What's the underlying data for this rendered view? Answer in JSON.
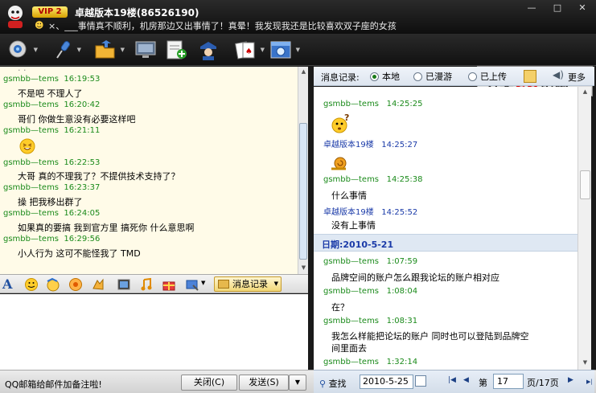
{
  "title_bar": {
    "vip_badge": "VIP 2",
    "contact_name": "卓越版本19楼(86526190)",
    "signature": "×、___事情真不顺利，机房那边又出事情了！真晕！我发现我还是比较喜欢双子座的女孩",
    "minimize": "—",
    "maximize": "□",
    "close": "✕"
  },
  "banner": {
    "text_a": "另类",
    "text_cg": "CG",
    "text_b": "花絮"
  },
  "chat": {
    "messages": [
      {
        "sender": "gsmbb—tems",
        "time": "16:19:53",
        "text": "不是吧 不理人了"
      },
      {
        "sender": "gsmbb—tems",
        "time": "16:20:42",
        "text": "哥们 你做生意没有必要这样吧"
      },
      {
        "sender": "gsmbb—tems",
        "time": "16:21:11",
        "text": ""
      },
      {
        "sender": "gsmbb—tems",
        "time": "16:22:53",
        "text": "大哥 真的不理我了？不提供技术支持了？"
      },
      {
        "sender": "gsmbb—tems",
        "time": "16:23:37",
        "text": "操 把我移出群了"
      },
      {
        "sender": "gsmbb—tems",
        "time": "16:24:05",
        "text": "如果真的要搞 我到官方里 搞死你 什么意思啊"
      },
      {
        "sender": "gsmbb—tems",
        "time": "16:29:56",
        "text": "小人行为 这可不能怪我了 TMD"
      }
    ]
  },
  "input_toolbar": {
    "history_button": "消息记录"
  },
  "bottom": {
    "tip": "QQ邮箱给邮件加备注啦!",
    "close_button": "关闭(C)",
    "send_button": "发送(S)",
    "send_dropdown": "▼"
  },
  "history": {
    "header_label": "消息记录:",
    "radio_local": "本地",
    "radio_roam": "已漫游",
    "radio_upload": "已上传",
    "more": "更多",
    "entries": [
      {
        "sender": "gsmbb—tems",
        "time": "14:25:25",
        "text": ""
      },
      {
        "sender": "卓越版本19楼",
        "time": "14:25:27",
        "text": ""
      },
      {
        "sender": "gsmbb—tems",
        "time": "14:25:38",
        "text": "什么事情"
      },
      {
        "sender": "卓越版本19楼",
        "time": "14:25:52",
        "text": "没有上事情"
      }
    ],
    "date_label": "日期:2010-5-21",
    "entries2": [
      {
        "sender": "gsmbb—tems",
        "time": "1:07:59",
        "text": "品牌空间的账户怎么跟我论坛的账户相对应"
      },
      {
        "sender": "gsmbb—tems",
        "time": "1:08:04",
        "text": "在？"
      },
      {
        "sender": "gsmbb—tems",
        "time": "1:08:31",
        "text": "我怎么样能把论坛的账户 同时也可以登陆到品牌空",
        "text2": "间里面去"
      },
      {
        "sender": "gsmbb—tems",
        "time": "1:32:14",
        "text": ""
      }
    ]
  },
  "history_footer": {
    "find_label": "查找",
    "date_value": "2010-5-25",
    "page_pre": "第",
    "page_value": "17",
    "page_post": "页/17页"
  },
  "colors": {
    "sender_green": "#1a8a1a",
    "sender_blue": "#1a3aa8",
    "chat_bg": "#fffbe8"
  }
}
